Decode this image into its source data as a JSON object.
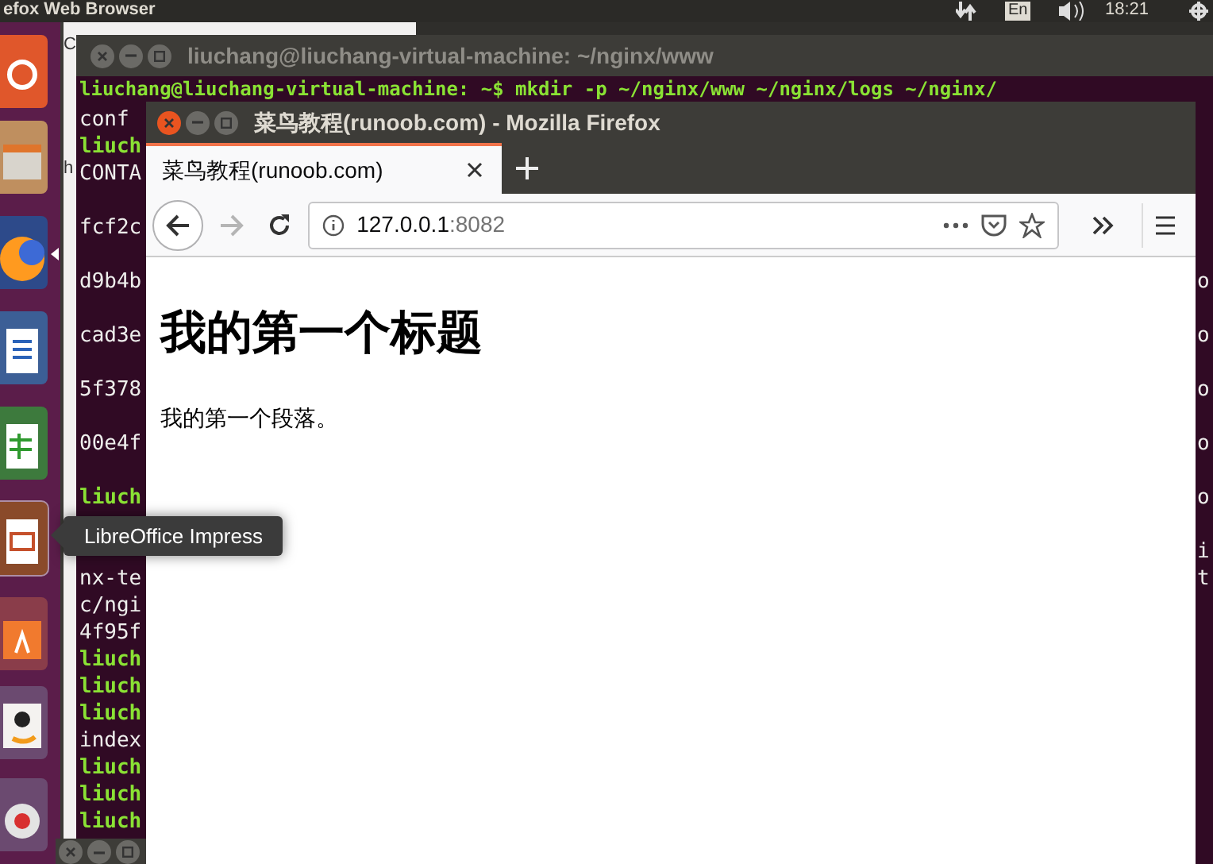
{
  "top_panel": {
    "app_title": "efox Web Browser",
    "keyboard": "En",
    "clock": "18:21"
  },
  "launcher": {
    "items": [
      {
        "kind": "ubuntu",
        "hovered": false
      },
      {
        "kind": "files",
        "hovered": false
      },
      {
        "kind": "firefox",
        "running": true,
        "hovered": false
      },
      {
        "kind": "writer",
        "hovered": false
      },
      {
        "kind": "calc",
        "hovered": false
      },
      {
        "kind": "impress",
        "hovered": true
      },
      {
        "kind": "store",
        "hovered": false
      },
      {
        "kind": "amazon",
        "hovered": false
      },
      {
        "kind": "settings",
        "hovered": false
      }
    ],
    "tooltip": "LibreOffice Impress"
  },
  "back_window": {
    "texts": [
      "C",
      "h"
    ]
  },
  "terminal": {
    "title": "liuchang@liuchang-virtual-machine: ~/nginx/www",
    "first_line": "liuchang@liuchang-virtual-machine: ~$ mkdir -p ~/nginx/www ~/nginx/logs ~/nginx/",
    "lines": [
      {
        "kind": "output",
        "left": "conf"
      },
      {
        "kind": "prompt",
        "left": "liuch"
      },
      {
        "kind": "output",
        "left": "CONTA"
      },
      {
        "kind": "blank"
      },
      {
        "kind": "output",
        "left": "fcf2c"
      },
      {
        "kind": "blank"
      },
      {
        "kind": "output",
        "left": "d9b4b",
        "right": "o"
      },
      {
        "kind": "blank"
      },
      {
        "kind": "output",
        "left": "cad3e",
        "right": "o"
      },
      {
        "kind": "blank"
      },
      {
        "kind": "output",
        "left": "5f378",
        "right": "o"
      },
      {
        "kind": "blank"
      },
      {
        "kind": "output",
        "left": "00e4f",
        "right": "o"
      },
      {
        "kind": "blank"
      },
      {
        "kind": "prompt",
        "left": "liuch",
        "right": "o"
      },
      {
        "kind": "blank"
      },
      {
        "kind": "output",
        "right": "i"
      },
      {
        "kind": "output",
        "left": "nx-te",
        "right": "t"
      },
      {
        "kind": "output",
        "left": "c/ngi"
      },
      {
        "kind": "output",
        "left": "4f95f"
      },
      {
        "kind": "prompt",
        "left": "liuch"
      },
      {
        "kind": "prompt",
        "left": "liuch"
      },
      {
        "kind": "prompt",
        "left": "liuch"
      },
      {
        "kind": "output",
        "left": "index"
      },
      {
        "kind": "prompt",
        "left": "liuch"
      },
      {
        "kind": "prompt",
        "left": "liuch"
      },
      {
        "kind": "prompt",
        "left": "liuch"
      }
    ]
  },
  "firefox": {
    "title": "菜鸟教程(runoob.com) - Mozilla Firefox",
    "tabs": [
      {
        "label": "菜鸟教程(runoob.com)",
        "selected": true
      }
    ],
    "back_disabled": false,
    "forward_disabled": true,
    "url_host": "127.0.0.1",
    "url_port": ":8082",
    "page": {
      "heading": "我的第一个标题",
      "paragraph": "我的第一个段落。"
    }
  }
}
